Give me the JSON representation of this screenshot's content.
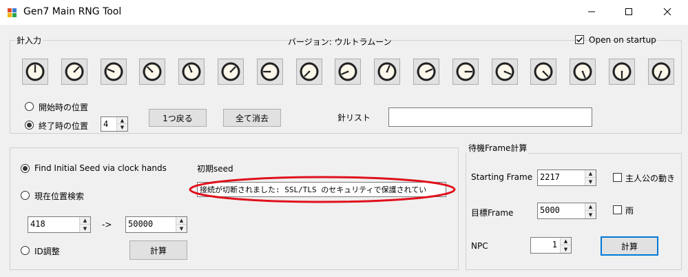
{
  "window": {
    "title": "Gen7 Main RNG Tool",
    "controls": {
      "minimize": "—",
      "maximize": "☐",
      "close": "✕"
    }
  },
  "needle_input": {
    "group_label": "針入力",
    "version_label": "バージョン: ウルトラムーン",
    "open_on_startup": {
      "label": "Open on startup",
      "checked": true
    },
    "clock_directions": [
      0,
      2,
      13,
      14,
      15,
      2,
      12,
      10,
      11,
      1,
      3,
      4,
      5,
      6,
      7,
      8,
      9
    ],
    "position_start_label": "開始時の位置",
    "position_end_label": "終了時の位置",
    "end_position_value": "4",
    "back_one_button": "1つ戻る",
    "clear_all_button": "全て消去",
    "needle_list_label": "針リスト",
    "needle_list_value": ""
  },
  "search": {
    "find_seed_label": "Find Initial Seed via clock hands",
    "current_position_label": "現在位置検索",
    "range_from": "418",
    "range_arrow": "->",
    "range_to": "50000",
    "id_adjust_label": "ID調整",
    "calc_button": "計算",
    "seed_label": "初期seed",
    "seed_value": "接続が切断されました: SSL/TLS のセキュリティで保護されてい"
  },
  "wait_frame": {
    "group_label": "待機Frame計算",
    "starting_frame_label": "Starting Frame",
    "starting_frame_value": "2217",
    "target_frame_label": "目標Frame",
    "target_frame_value": "5000",
    "npc_label": "NPC",
    "npc_value": "1",
    "protagonist_label": "主人公の動き",
    "rain_label": "雨",
    "calc_button": "計算"
  },
  "colors": {
    "window_bg": "#f0f0f0",
    "accent_blue": "#0078d7",
    "annotation_red": "#e0101a",
    "clock_face": "#fbf7ea",
    "clock_ring": "#1f1f1f"
  }
}
